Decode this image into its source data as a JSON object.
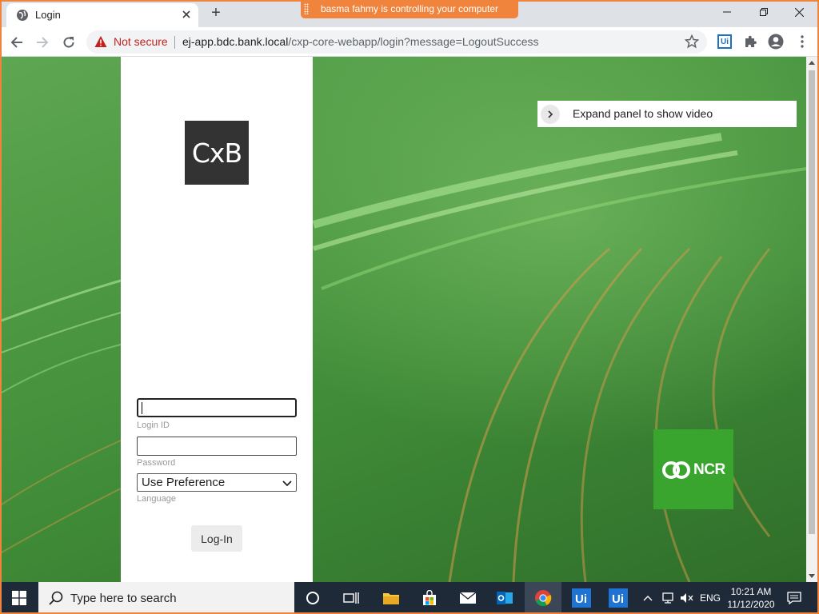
{
  "browser": {
    "tab_title": "Login",
    "control_banner": "basma fahmy is controlling your computer",
    "security_label": "Not secure",
    "url_host": "ej-app.bdc.bank.local",
    "url_path": "/cxp-core-webapp/login?message=LogoutSuccess",
    "extension_label": "Ui"
  },
  "login": {
    "logo_text": "CxB",
    "login_id_value": "",
    "login_id_label": "Login ID",
    "password_value": "",
    "password_label": "Password",
    "language_selected": "Use Preference",
    "language_label": "Language",
    "submit_label": "Log-In"
  },
  "video_panel": {
    "expand_text": "Expand panel to show video"
  },
  "brand": {
    "ncr_text": "NCR",
    "ncr_color": "#3aa52e",
    "logo_bg": "#333333"
  },
  "taskbar": {
    "search_placeholder": "Type here to search",
    "apps": [
      "task-view",
      "file-explorer",
      "microsoft-store",
      "mail",
      "outlook",
      "chrome",
      "uipath-studio",
      "uipath-robot"
    ],
    "language": "ENG",
    "time": "10:21 AM",
    "date": "11/12/2020"
  },
  "colors": {
    "frame": "#f0843c",
    "not_secure": "#c5221f",
    "taskbar": "#1f2a38"
  }
}
